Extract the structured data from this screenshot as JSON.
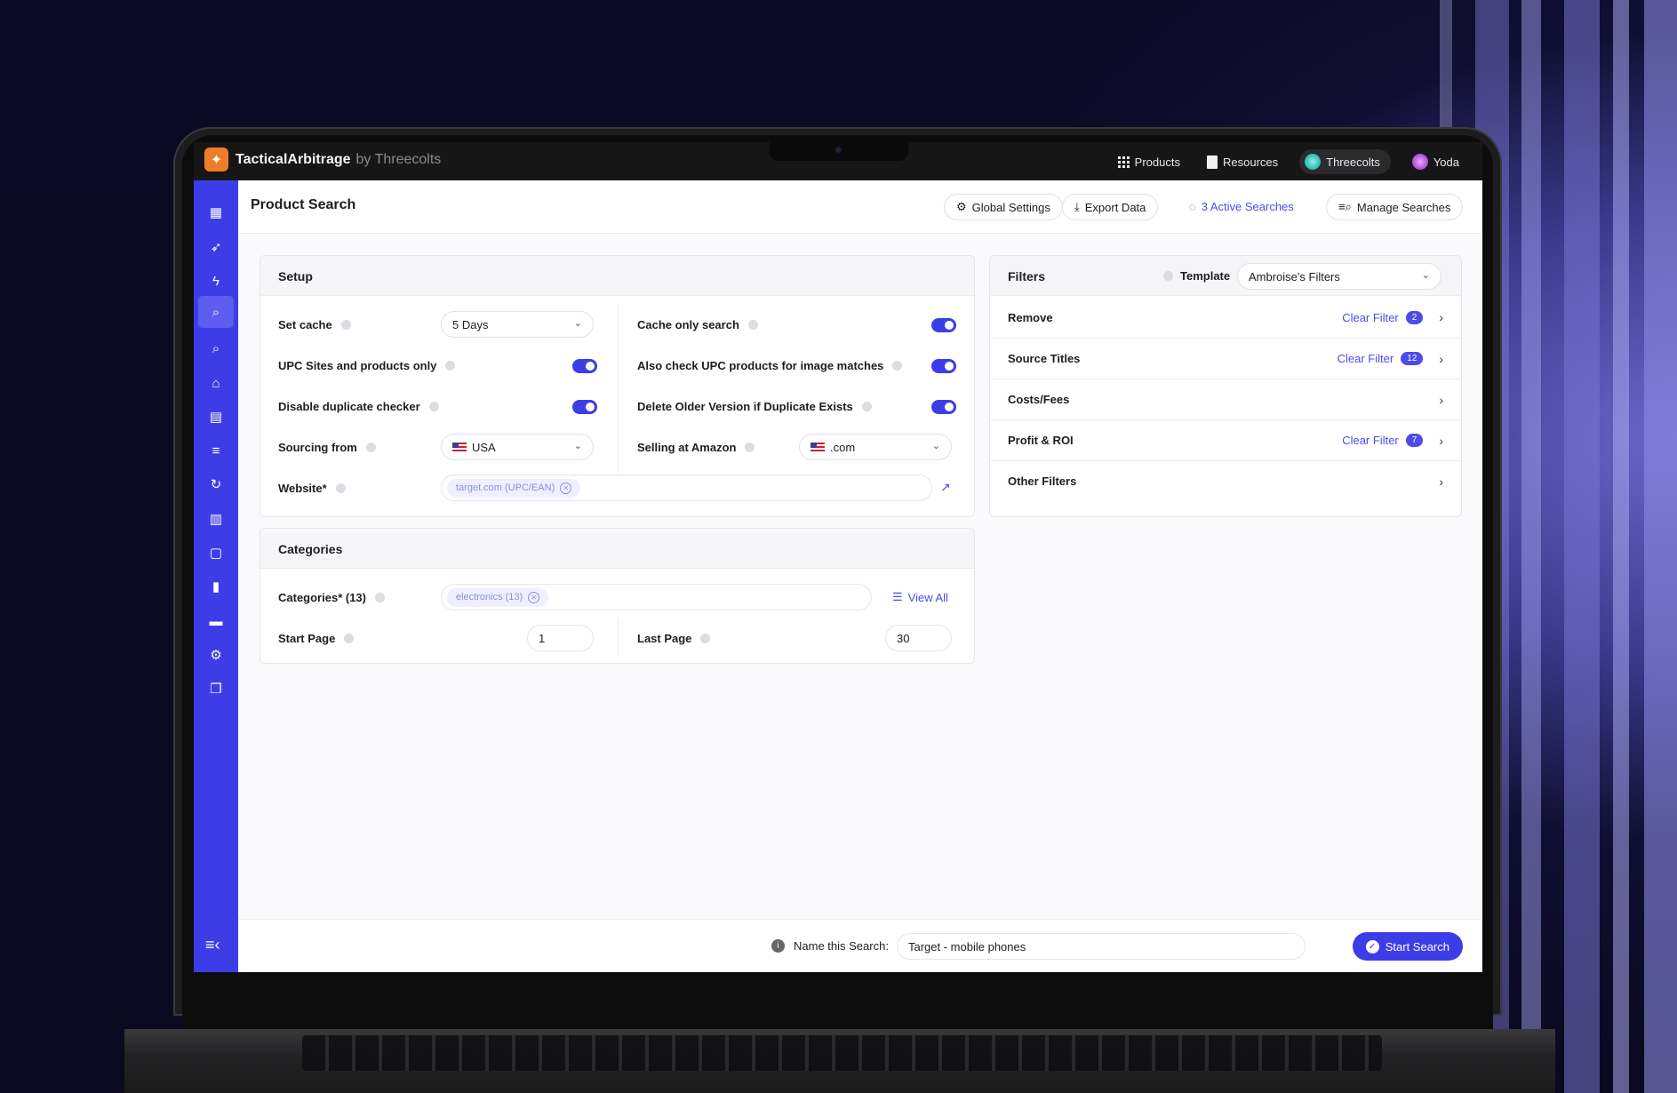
{
  "app": {
    "brand_name": "TacticalArbitrage",
    "brand_by": "by Threecolts"
  },
  "topnav": {
    "products": "Products",
    "resources": "Resources",
    "threecolts": "Threecolts",
    "user": "Yoda"
  },
  "header": {
    "title": "Product Search",
    "global_settings": "Global Settings",
    "export_data": "Export Data",
    "active_searches": "3 Active Searches",
    "manage_searches": "Manage Searches"
  },
  "setup": {
    "title": "Setup",
    "set_cache_label": "Set cache",
    "set_cache_value": "5 Days",
    "cache_only_label": "Cache only search",
    "upc_only_label": "UPC Sites and products only",
    "also_check_label": "Also check UPC products for image matches",
    "disable_dup_label": "Disable duplicate checker",
    "delete_older_label": "Delete Older Version if Duplicate Exists",
    "sourcing_label": "Sourcing from",
    "sourcing_value": "USA",
    "selling_label": "Selling at Amazon",
    "selling_value": ".com",
    "website_label": "Website*",
    "website_chip": "target.com (UPC/EAN)"
  },
  "categories": {
    "title": "Categories",
    "label": "Categories* (13)",
    "chip": "electronics (13)",
    "view_all": "View All",
    "start_page_label": "Start Page",
    "start_page_value": "1",
    "last_page_label": "Last Page",
    "last_page_value": "30"
  },
  "filters": {
    "title": "Filters",
    "template_label": "Template",
    "template_value": "Ambroise's Filters",
    "rows": [
      {
        "label": "Remove",
        "clear": "Clear Filter",
        "count": "2"
      },
      {
        "label": "Source Titles",
        "clear": "Clear Filter",
        "count": "12"
      },
      {
        "label": "Costs/Fees",
        "clear": "",
        "count": ""
      },
      {
        "label": "Profit & ROI",
        "clear": "Clear Filter",
        "count": "7"
      },
      {
        "label": "Other Filters",
        "clear": "",
        "count": ""
      }
    ]
  },
  "footer": {
    "name_label": "Name this Search:",
    "name_value": "Target - mobile phones",
    "start_button": "Start Search"
  },
  "colors": {
    "accent": "#3d3de8",
    "brand_orange": "#f07c2a"
  }
}
